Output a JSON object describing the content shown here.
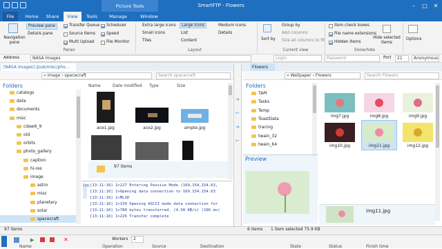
{
  "app": {
    "title": "SmartFTP - Flowers",
    "context_tab": "Picture Tools"
  },
  "tabs": [
    "File",
    "Home",
    "Share",
    "View",
    "Tools",
    "Manage",
    "Window"
  ],
  "ribbon": {
    "nav_pane": "Navigation pane",
    "preview_pane": "Preview pane",
    "details_pane": "Details pane",
    "transfer_queue": "Transfer Queue",
    "source_items": "Source Items",
    "multi_upload": "Multi Upload",
    "scheduler": "Scheduler",
    "speed": "Speed",
    "file_monitor": "File Monitor",
    "panes_label": "Panes",
    "layouts": [
      "Extra large icons",
      "Large icons",
      "Medium icons",
      "Small icons",
      "List",
      "Details",
      "Tiles",
      "Content"
    ],
    "layout_label": "Layout",
    "sort_by": "Sort by",
    "group_by": "Group by",
    "add_columns": "Add columns",
    "size_all": "Size all columns to fit",
    "current_view": "Current view",
    "item_checkboxes": "Item check boxes",
    "file_ext": "File name extensions",
    "hidden_items": "Hidden items",
    "hide_selected": "Hide selected items",
    "show_hide": "Show/hide",
    "options": "Options"
  },
  "address": {
    "label": "Address",
    "value": "NASA Images",
    "login_ph": "Login",
    "password_ph": "Password",
    "port_label": "Port",
    "port": "21",
    "anonymous": "Anonymous"
  },
  "left_panel": {
    "tab": "[NASA Images] /pub/misc/pho...",
    "path": "« image › spacecraft",
    "search": "Search spacecraft",
    "folders_header": "Folders",
    "cols": [
      "Name",
      "Date modified",
      "Type",
      "Size"
    ],
    "tree": [
      {
        "label": "catalogs",
        "indent": 0
      },
      {
        "label": "data",
        "indent": 0
      },
      {
        "label": "documents",
        "indent": 0
      },
      {
        "label": "misc",
        "indent": 0
      },
      {
        "label": "cdaw6_9",
        "indent": 1
      },
      {
        "label": "old",
        "indent": 1
      },
      {
        "label": "orbits",
        "indent": 1
      },
      {
        "label": "photo_gallery",
        "indent": 1
      },
      {
        "label": "caption",
        "indent": 2
      },
      {
        "label": "hi-res",
        "indent": 2
      },
      {
        "label": "image",
        "indent": 2
      },
      {
        "label": "astro",
        "indent": 3
      },
      {
        "label": "misc",
        "indent": 3
      },
      {
        "label": "planetary",
        "indent": 3
      },
      {
        "label": "solar",
        "indent": 3
      },
      {
        "label": "spacecraft",
        "indent": 3
      }
    ],
    "files": [
      "ace1.jpg",
      "ace2.jpg",
      "ampte.jpg"
    ],
    "folder_count": "97 items",
    "status": "97 items"
  },
  "log": [
    "[13:11:16] 1>227 Entering Passive Mode (169,154,154,63,",
    "[13:11:16] 1>Opening data connection to 169.154.154.63",
    "[13:11:16] 1>MLSD",
    "[13:11:16] 1>150 Opening ASCII mode data connection for",
    "[13:11:16] 1>780 bytes transferred. (4.58 KB/s) (166 ms)",
    "[13:11:16] 1>226 Transfer complete"
  ],
  "right_panel": {
    "tab": "Flowers",
    "path": "« Wallpaper › Flowers",
    "search": "Search Flowers",
    "folders_header": "Folders",
    "tree": [
      "TAPI",
      "Tasks",
      "Temp",
      "ToastData",
      "tracing",
      "twain_32",
      "twain_64"
    ],
    "preview_header": "Preview",
    "images": [
      "img7.jpg",
      "img8.jpg",
      "img9.jpg",
      "img10.jpg",
      "img11.jpg",
      "img12.jpg"
    ],
    "selected_name": "img11.jpg",
    "status_items": "6 items",
    "status_sel": "1 item selected  75.9 KB"
  },
  "bottom": {
    "workers_label": "Workers",
    "workers": "2",
    "cols": [
      "Name",
      "Operation",
      "Source",
      "Destination",
      "State",
      "Status",
      "Finish time"
    ]
  },
  "colors": {
    "accent": "#1e6fc0",
    "ribbon_bg": "#f3f3f3",
    "selection": "#cde4f7"
  }
}
